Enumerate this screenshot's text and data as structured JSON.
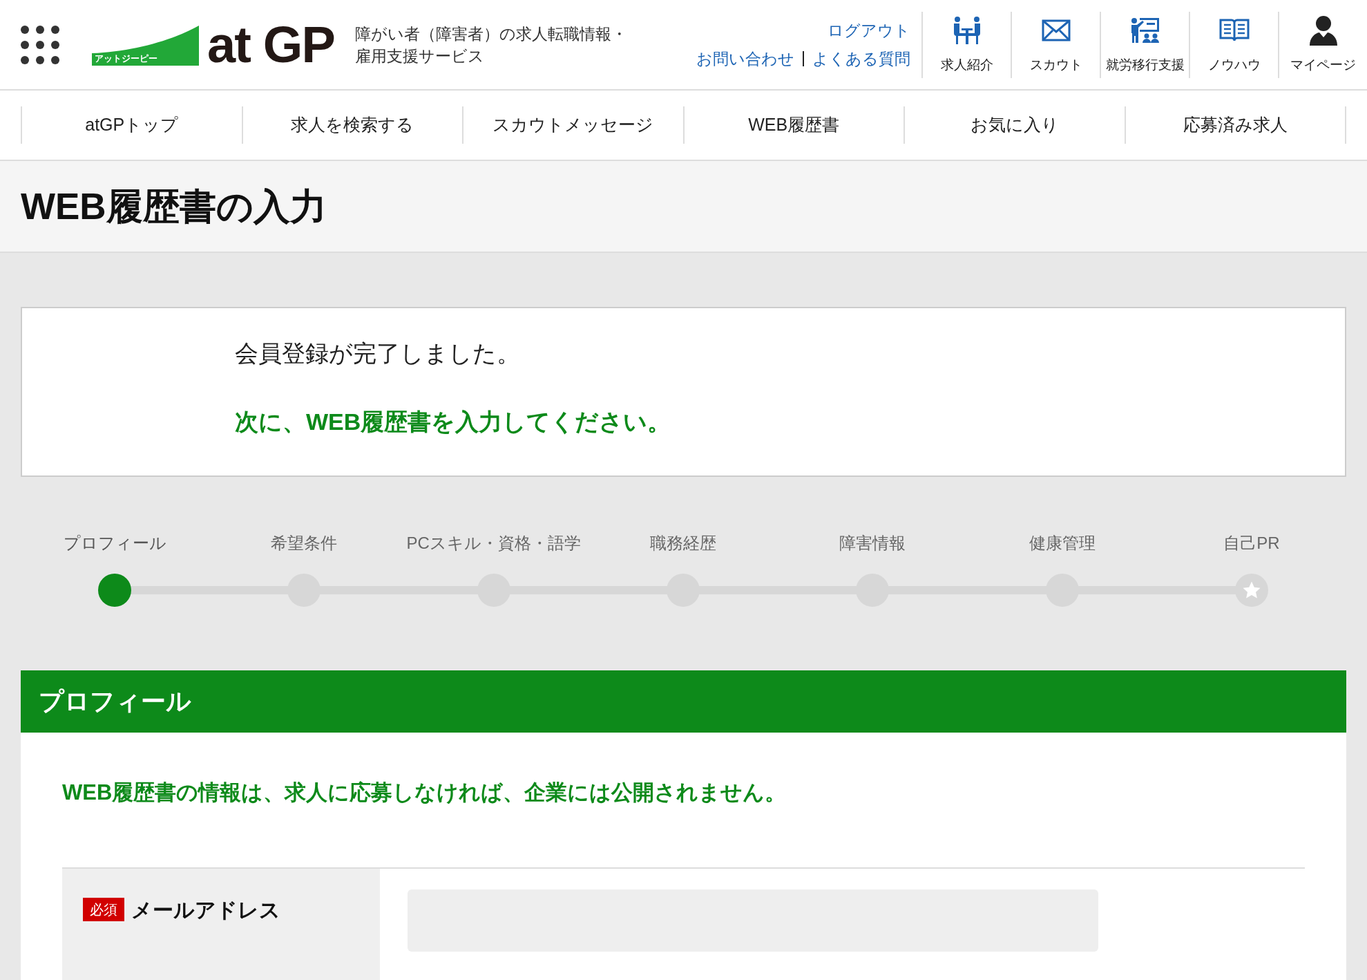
{
  "header": {
    "logo": {
      "tagline": "アットジーピー",
      "wordmark": "at GP"
    },
    "description": [
      "障がい者（障害者）の求人転職情報・",
      "雇用支援サービス"
    ],
    "links": [
      {
        "label": "ログアウト"
      },
      {
        "label": "お問い合わせ"
      },
      {
        "label": "よくある質問"
      }
    ],
    "icon_nav": [
      {
        "kind": "meeting",
        "label": "求人紹介"
      },
      {
        "kind": "mail",
        "label": "スカウト"
      },
      {
        "kind": "training",
        "label": "就労移行支援"
      },
      {
        "kind": "book",
        "label": "ノウハウ"
      },
      {
        "kind": "user",
        "label": "マイページ"
      }
    ]
  },
  "main_nav": [
    {
      "label": "atGPトップ"
    },
    {
      "label": "求人を検索する"
    },
    {
      "label": "スカウトメッセージ"
    },
    {
      "label": "WEB履歴書"
    },
    {
      "label": "お気に入り"
    },
    {
      "label": "応募済み求人"
    }
  ],
  "page_title": "WEB履歴書の入力",
  "notice": {
    "message": "会員登録が完了しました。",
    "next_step": "次に、WEB履歴書を入力してください。"
  },
  "steps": [
    {
      "label": "プロフィール",
      "selected": true,
      "kind": "step"
    },
    {
      "label": "希望条件",
      "selected": false,
      "kind": "step"
    },
    {
      "label": "PCスキル・資格・語学",
      "selected": false,
      "kind": "step"
    },
    {
      "label": "職務経歴",
      "selected": false,
      "kind": "step"
    },
    {
      "label": "障害情報",
      "selected": false,
      "kind": "step"
    },
    {
      "label": "健康管理",
      "selected": false,
      "kind": "step"
    },
    {
      "label": "自己PR",
      "selected": false,
      "kind": "goal"
    }
  ],
  "section": {
    "title": "プロフィール",
    "note": "WEB履歴書の情報は、求人に応募しなければ、企業には公開されません。",
    "fields": [
      {
        "badge": "必須",
        "label": "メールアドレス"
      }
    ]
  }
}
